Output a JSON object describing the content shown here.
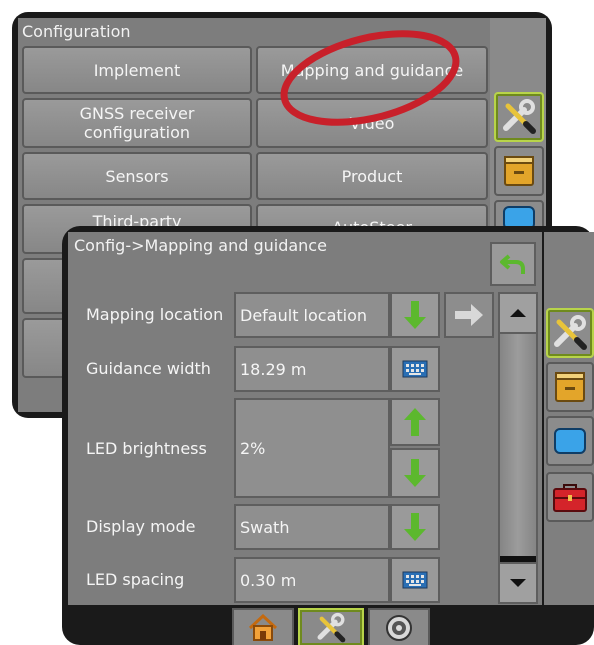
{
  "back_screen": {
    "title": "Configuration",
    "buttons": [
      {
        "label": "Implement"
      },
      {
        "label": "Mapping and guidance"
      },
      {
        "label": "GNSS receiver configuration"
      },
      {
        "label": "Video"
      },
      {
        "label": "Sensors"
      },
      {
        "label": "Product"
      },
      {
        "label": "Third-party"
      },
      {
        "label": "AutoSteer"
      }
    ]
  },
  "front_screen": {
    "title": "Config->Mapping and guidance",
    "rows": [
      {
        "label": "Mapping location",
        "value": "Default location"
      },
      {
        "label": "Guidance width",
        "value": "18.29 m"
      },
      {
        "label": "LED brightness",
        "value": "2%"
      },
      {
        "label": "Display mode",
        "value": "Swath"
      },
      {
        "label": "LED spacing",
        "value": "0.30 m"
      }
    ]
  },
  "colors": {
    "highlight_circle": "#c8202a",
    "green_arrow": "#5cb82e",
    "screen_bg": "#7d7d7d",
    "active_tab_border": "#b8d44a"
  }
}
